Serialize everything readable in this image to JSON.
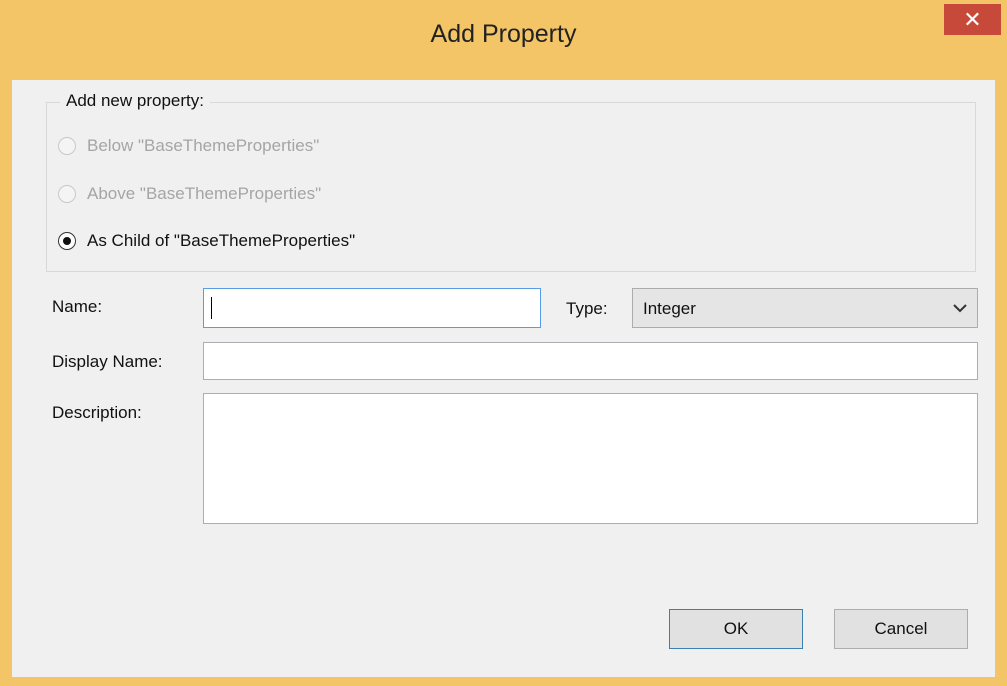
{
  "window": {
    "title": "Add Property",
    "close_glyph": "✕",
    "frame_color": "#f3c567",
    "close_color": "#c7493a"
  },
  "group": {
    "title": "Add new property:",
    "options": [
      {
        "label": "Below \"BaseThemeProperties\"",
        "selected": false,
        "enabled": false
      },
      {
        "label": "Above \"BaseThemeProperties\"",
        "selected": false,
        "enabled": false
      },
      {
        "label": "As Child of \"BaseThemeProperties\"",
        "selected": true,
        "enabled": true
      }
    ]
  },
  "form": {
    "name_label": "Name:",
    "name_value": "",
    "type_label": "Type:",
    "type_value": "Integer",
    "display_name_label": "Display Name:",
    "display_name_value": "",
    "description_label": "Description:",
    "description_value": ""
  },
  "buttons": {
    "ok": "OK",
    "cancel": "Cancel"
  },
  "icons": {
    "close": "close-icon",
    "combo_arrow": "chevron-down-icon",
    "radio": "radio-button-icon"
  }
}
